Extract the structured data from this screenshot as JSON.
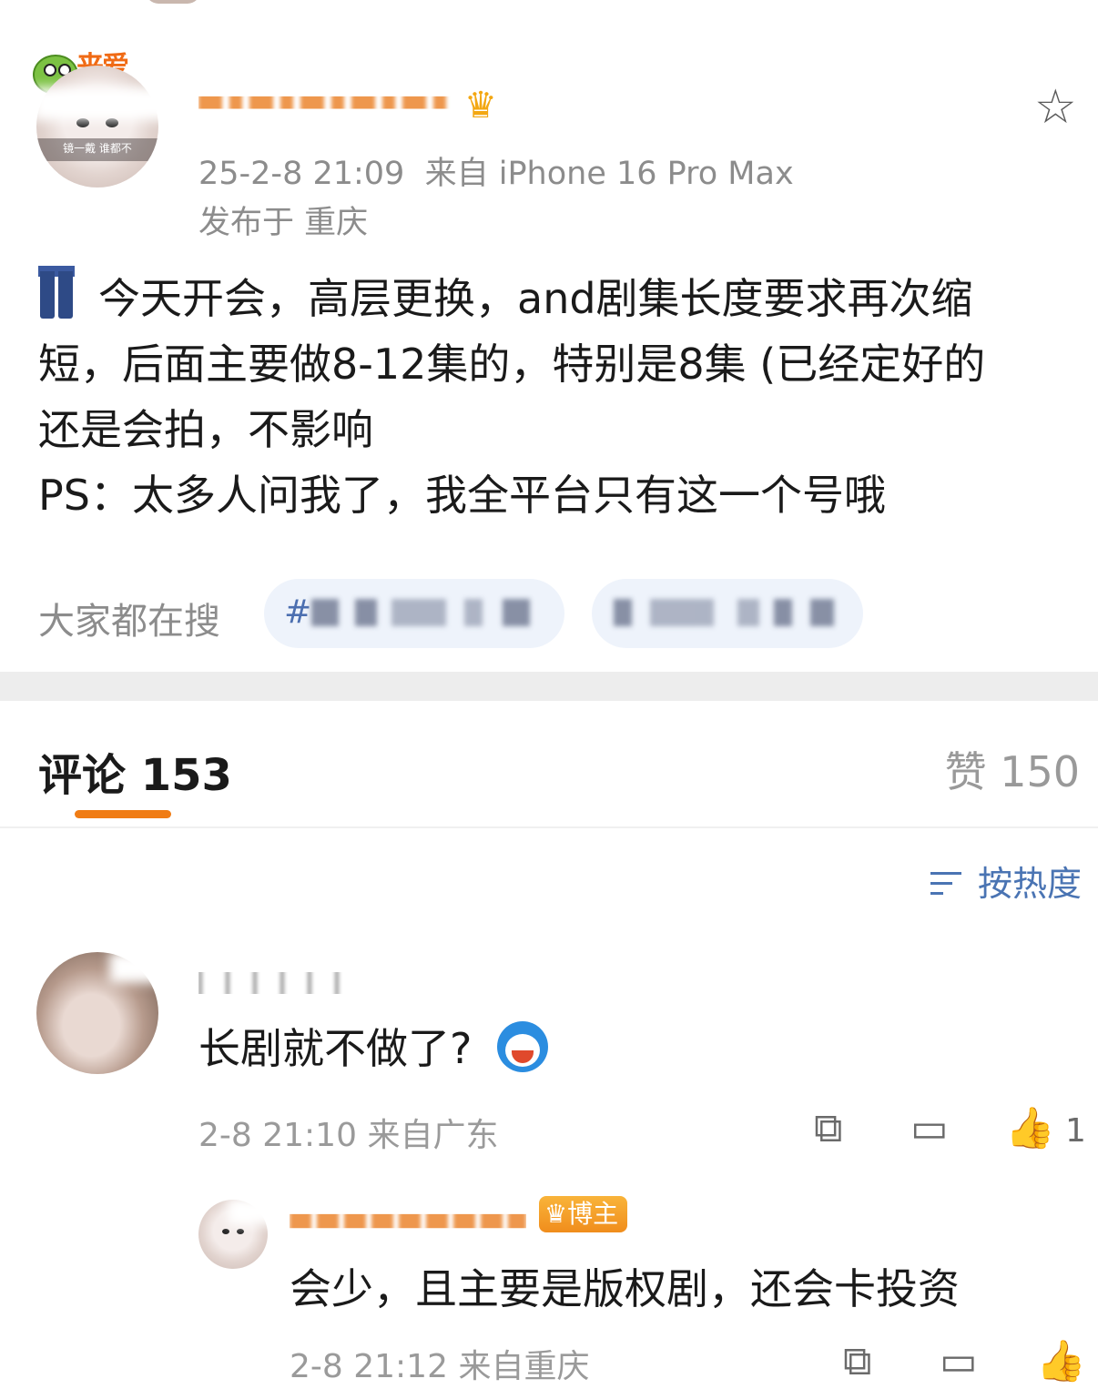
{
  "post": {
    "author_badge_text": "来爱",
    "author_avatar_caption": "镜一戴 谁都不",
    "meta_time": "25-2-8 21:09",
    "meta_device": "来自 iPhone 16 Pro Max",
    "meta_location": "发布于 重庆",
    "body_lines": [
      "今天开会，高层更换，and剧集长度要求再次缩",
      "短，后面主要做8-12集的，特别是8集 (已经定好的",
      "还是会拍，不影响",
      "PS：太多人问我了，我全平台只有这一个号哦"
    ],
    "search_label": "大家都在搜",
    "search_chip1_hash": "#",
    "icons": {
      "favorite": "star-icon",
      "author_level": "crown-icon",
      "emoji": "jeans-emoji"
    }
  },
  "tabs": {
    "comments_label": "评论 153",
    "likes_label": "赞 150",
    "accent_color": "#f07c14"
  },
  "sort": {
    "label": "按热度",
    "icon": "sort-icon"
  },
  "comment": {
    "text": "长剧就不做了?",
    "emoji": "doraemon-emoji",
    "time": "2-8 21:10",
    "location": "来自广东",
    "like_count": "1"
  },
  "reply": {
    "badge": "博主",
    "text": "会少，且主要是版权剧，还会卡投资",
    "time": "2-8 21:12",
    "location": "来自重庆"
  }
}
